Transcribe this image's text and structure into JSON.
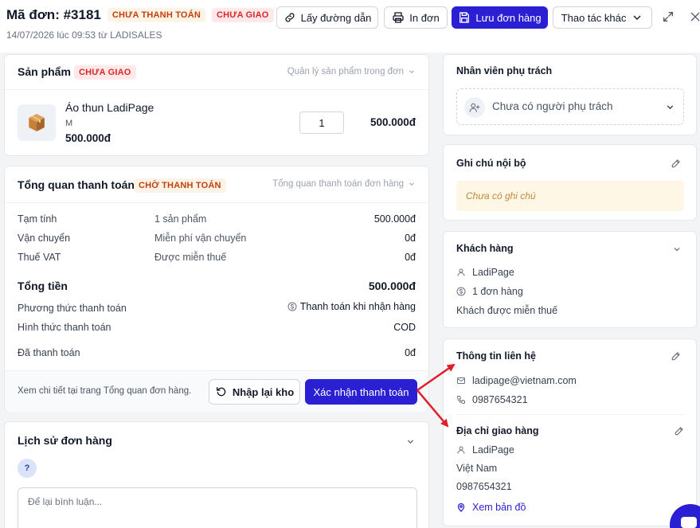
{
  "header": {
    "order_label": "Mã đơn: #3181",
    "badge_payment": "CHƯA THANH TOÁN",
    "badge_delivery": "CHƯA GIAO",
    "subtitle": "14/07/2026 lúc 09:53 từ LADISALES",
    "btn_link": "Lấy đường dẫn",
    "btn_print": "In đơn",
    "btn_save": "Lưu đơn hàng",
    "btn_more": "Thao tác khác"
  },
  "products": {
    "title": "Sản phẩm",
    "badge": "CHƯA GIAO",
    "manage_link": "Quản lý sản phẩm trong đơn",
    "item_name": "Áo thun LadiPage",
    "item_variant": "M",
    "item_price": "500.000đ",
    "item_qty": "1",
    "item_total": "500.000đ"
  },
  "payment": {
    "title": "Tổng quan thanh toán",
    "badge": "CHỜ THANH TOÁN",
    "overview_link": "Tổng quan thanh toán đơn hàng",
    "rows": [
      {
        "label": "Tạm tính",
        "mid": "1 sản phẩm",
        "value": "500.000đ"
      },
      {
        "label": "Vận chuyển",
        "mid": "Miễn phí vận chuyển",
        "value": "0đ"
      },
      {
        "label": "Thuế VAT",
        "mid": "Được miễn thuế",
        "value": "0đ"
      }
    ],
    "total_label": "Tổng tiền",
    "total_value": "500.000đ",
    "method_label": "Phương thức thanh toán",
    "method_value": "Thanh toán khi nhận hàng",
    "form_label": "Hình thức thanh toán",
    "form_value": "COD",
    "paid_label": "Đã thanh toán",
    "paid_value": "0đ",
    "footer_note": "Xem chi tiết tại trang Tổng quan đơn hàng.",
    "btn_restock": "Nhập lại kho",
    "btn_confirm": "Xác nhận thanh toán"
  },
  "history": {
    "title": "Lịch sử đơn hàng",
    "avatar": "?",
    "comment_placeholder": "Để lại bình luận..."
  },
  "staff": {
    "title": "Nhân viên phụ trách",
    "select_text": "Chưa có người phụ trách"
  },
  "note": {
    "title": "Ghi chú nội bộ",
    "empty": "Chưa có ghi chú"
  },
  "customer": {
    "title": "Khách hàng",
    "name": "LadiPage",
    "orders": "1 đơn hàng",
    "tax": "Khách được miễn thuế"
  },
  "contact": {
    "title": "Thông tin liên hệ",
    "email": "ladipage@vietnam.com",
    "phone": "0987654321"
  },
  "shipping": {
    "title": "Địa chỉ giao hàng",
    "name": "LadiPage",
    "country": "Việt Nam",
    "phone": "0987654321",
    "map_link": "Xem bản đồ"
  },
  "colors": {
    "primary": "#2b1fd4",
    "arrow": "#e11d2a",
    "note_bg": "#fff7e6"
  }
}
